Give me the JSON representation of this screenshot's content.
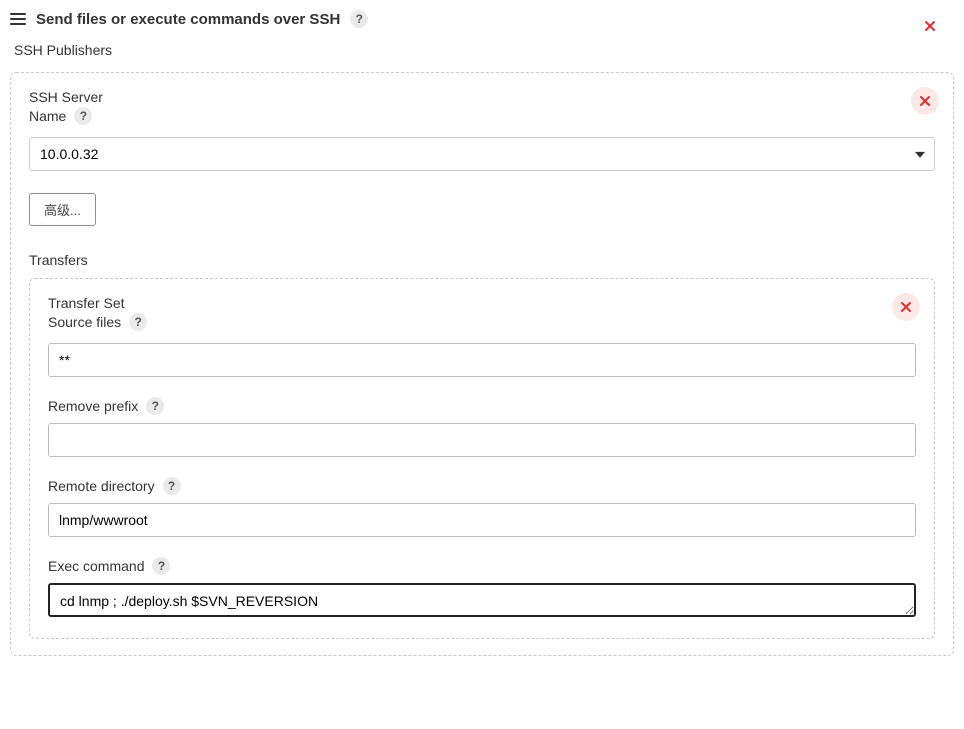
{
  "header": {
    "title": "Send files or execute commands over SSH"
  },
  "publishers": {
    "label": "SSH Publishers"
  },
  "server": {
    "title_line1": "SSH Server",
    "name_label": "Name",
    "selected": "10.0.0.32",
    "advanced_label": "高级..."
  },
  "transfers": {
    "section_label": "Transfers",
    "set_title": "Transfer Set",
    "source_files_label": "Source files",
    "source_files_value": "**",
    "remove_prefix_label": "Remove prefix",
    "remove_prefix_value": "",
    "remote_dir_label": "Remote directory",
    "remote_dir_value": "lnmp/wwwroot",
    "exec_label": "Exec command",
    "exec_value": "cd lnmp ; ./deploy.sh $SVN_REVERSION"
  },
  "icons": {
    "help_glyph": "?"
  }
}
